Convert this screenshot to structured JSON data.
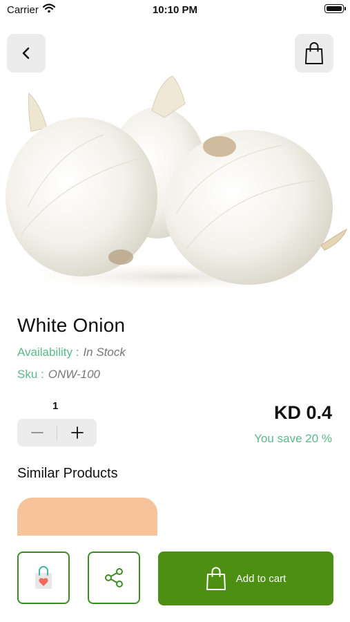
{
  "status_bar": {
    "carrier": "Carrier",
    "time": "10:10 PM"
  },
  "product": {
    "name": "White Onion",
    "availability_label": "Availability :",
    "availability_value": "In Stock",
    "sku_label": "Sku :",
    "sku_value": "ONW-100",
    "quantity": "1",
    "price": "KD 0.4",
    "savings": "You save 20 %"
  },
  "similar": {
    "heading": "Similar Products"
  },
  "actions": {
    "add_to_cart": "Add to cart"
  },
  "colors": {
    "accent_green": "#5cb88a",
    "button_green": "#4c8f12",
    "outline_green": "#3d8c22",
    "card_peach": "#f7c39a"
  },
  "icons": [
    "wifi-icon",
    "battery-icon",
    "back-chevron-icon",
    "shopping-bag-icon",
    "minus-icon",
    "plus-icon",
    "wishlist-bag-heart-icon",
    "share-icon",
    "cart-bag-icon"
  ]
}
